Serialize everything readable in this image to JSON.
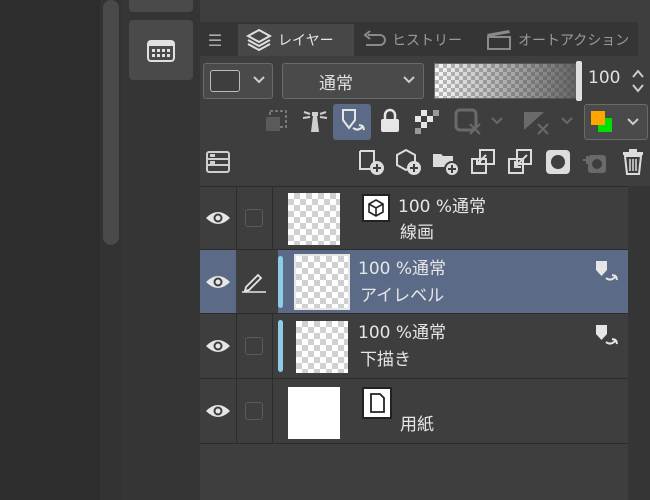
{
  "tabs": [
    {
      "label": "レイヤー",
      "icon": "layers-icon",
      "active": true
    },
    {
      "label": "ヒストリー",
      "icon": "history-icon",
      "active": false
    },
    {
      "label": "オートアクション",
      "icon": "clapperboard-icon",
      "active": false
    }
  ],
  "blend": {
    "mode": "通常",
    "opacity": "100"
  },
  "layers": [
    {
      "name": "線画",
      "info": "100 %通常",
      "type": "vector",
      "selected": false,
      "editing": false,
      "clipped": false
    },
    {
      "name": "アイレベル",
      "info": "100 %通常",
      "type": "raster",
      "selected": true,
      "editing": true,
      "clipped": true,
      "reference": true
    },
    {
      "name": "下描き",
      "info": "100 %通常",
      "type": "raster",
      "selected": false,
      "editing": false,
      "clipped": true,
      "reference": true
    },
    {
      "name": "用紙",
      "info": "",
      "type": "paper",
      "selected": false,
      "editing": false,
      "clipped": false
    }
  ],
  "colors": {
    "accent_selected": "#5b6a86",
    "clip_bar": "#8ecbe6",
    "highlight_orange": "#ffa500",
    "highlight_green": "#00e000"
  }
}
